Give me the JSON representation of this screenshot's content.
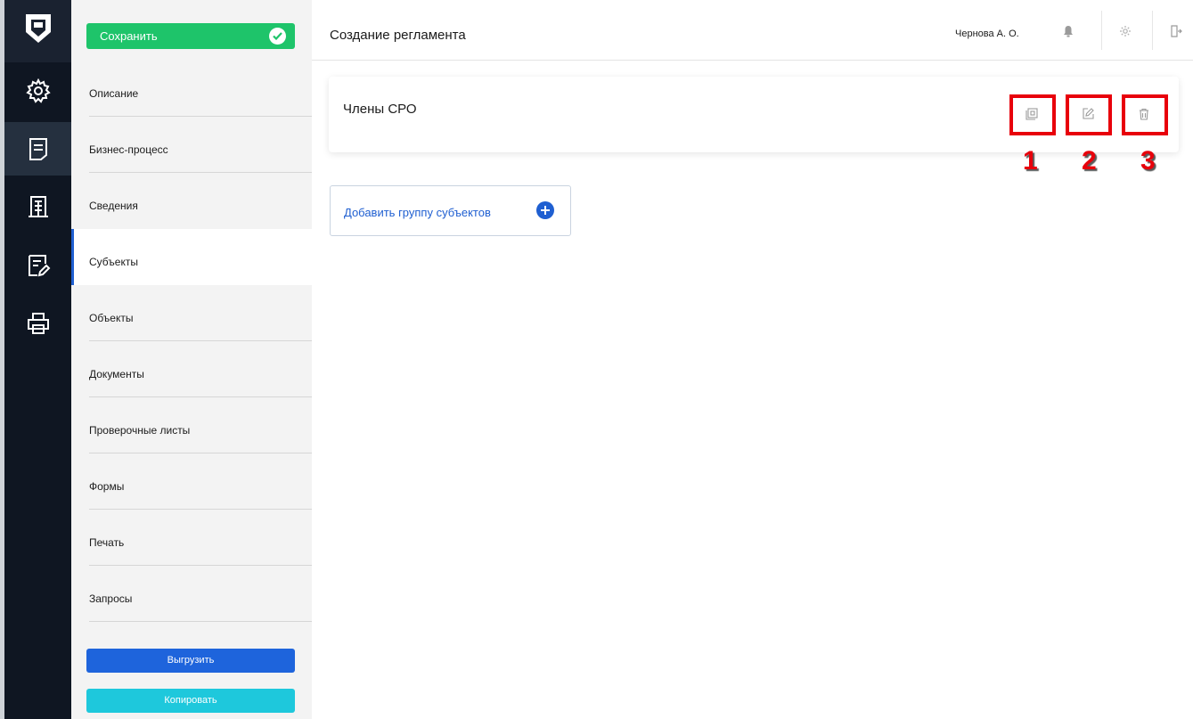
{
  "toolbar": {
    "save_label": "Сохранить"
  },
  "header": {
    "title": "Создание регламента",
    "user": "Чернова А. О."
  },
  "nav": {
    "items": [
      {
        "label": "Описание"
      },
      {
        "label": "Бизнес-процесс"
      },
      {
        "label": "Сведения"
      },
      {
        "label": "Субъекты"
      },
      {
        "label": "Объекты"
      },
      {
        "label": "Документы"
      },
      {
        "label": "Проверочные листы"
      },
      {
        "label": "Формы"
      },
      {
        "label": "Печать"
      },
      {
        "label": "Запросы"
      }
    ],
    "active": "Субъекты",
    "export_label": "Выгрузить",
    "copy_label": "Копировать"
  },
  "rail": {
    "icons": [
      "logo-shield-icon",
      "gear-icon",
      "document-icon",
      "building-icon",
      "edit-form-icon",
      "printer-icon"
    ]
  },
  "card": {
    "title": "Члены СРО",
    "actions": [
      {
        "icon": "copy-icon",
        "marker": "1"
      },
      {
        "icon": "edit-icon",
        "marker": "2"
      },
      {
        "icon": "trash-icon",
        "marker": "3"
      }
    ]
  },
  "add_group": {
    "label": "Добавить группу субъектов"
  },
  "colors": {
    "save": "#1ec46a",
    "accent": "#1f5fd1",
    "export": "#1e64dc",
    "copy": "#1ec8dc",
    "highlight": "#e8000b",
    "rail": "#0f1622"
  }
}
